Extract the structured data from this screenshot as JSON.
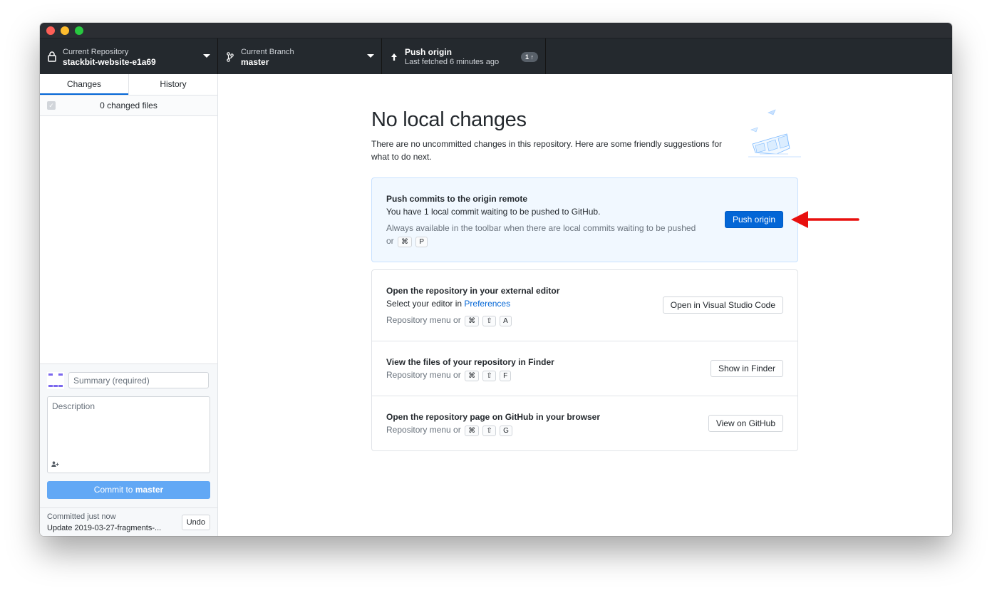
{
  "toolbar": {
    "repo_label": "Current Repository",
    "repo_name": "stackbit-website-e1a69",
    "branch_label": "Current Branch",
    "branch_name": "master",
    "push_title": "Push origin",
    "push_subtitle": "Last fetched 6 minutes ago",
    "push_badge": "1 ↑"
  },
  "sidebar": {
    "tabs": [
      "Changes",
      "History"
    ],
    "active_tab": "Changes",
    "changed_files": "0 changed files",
    "summary_placeholder": "Summary (required)",
    "description_placeholder": "Description",
    "commit_prefix": "Commit to",
    "commit_branch": "master",
    "last_commit_label": "Committed just now",
    "last_commit_message": "Update 2019-03-27-fragments-...",
    "undo_label": "Undo"
  },
  "main": {
    "heading": "No local changes",
    "subtitle": "There are no uncommitted changes in this repository. Here are some friendly suggestions for what to do next.",
    "push_card": {
      "title": "Push commits to the origin remote",
      "desc_prefix": "You have",
      "count": "1",
      "desc_suffix": "local commit waiting to be pushed to GitHub.",
      "hint": "Always available in the toolbar when there are local commits waiting to be pushed or",
      "keys": [
        "⌘",
        "P"
      ],
      "button": "Push origin"
    },
    "editor_card": {
      "title": "Open the repository in your external editor",
      "desc_prefix": "Select your editor in",
      "desc_link": "Preferences",
      "hint": "Repository menu or",
      "keys": [
        "⌘",
        "⇧",
        "A"
      ],
      "button": "Open in Visual Studio Code"
    },
    "finder_card": {
      "title": "View the files of your repository in Finder",
      "hint": "Repository menu or",
      "keys": [
        "⌘",
        "⇧",
        "F"
      ],
      "button": "Show in Finder"
    },
    "github_card": {
      "title": "Open the repository page on GitHub in your browser",
      "hint": "Repository menu or",
      "keys": [
        "⌘",
        "⇧",
        "G"
      ],
      "button": "View on GitHub"
    }
  },
  "colors": {
    "accent": "#0366d6",
    "toolbar_bg": "#24292e",
    "commit_button": "#62a8f5",
    "annotation_arrow": "#e8100f"
  },
  "icons": [
    "lock-icon",
    "branch-icon",
    "arrow-up-icon",
    "caret-down-icon",
    "checkbox-icon",
    "avatar-icon",
    "coauthor-icon",
    "illustration",
    "annotation-arrow"
  ]
}
